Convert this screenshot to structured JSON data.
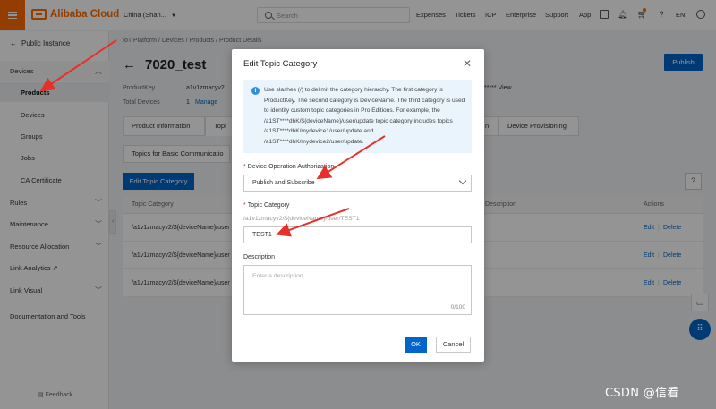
{
  "topbar": {
    "brand": "Alibaba Cloud",
    "region": "China (Shan...",
    "search_placeholder": "Search",
    "nav": [
      "Expenses",
      "Tickets",
      "ICP",
      "Enterprise",
      "Support",
      "App"
    ],
    "lang": "EN"
  },
  "sidebar": {
    "back": "Public Instance",
    "items": [
      {
        "label": "Devices"
      },
      {
        "label": "Products"
      },
      {
        "label": "Devices"
      },
      {
        "label": "Groups"
      },
      {
        "label": "Jobs"
      },
      {
        "label": "CA Certificate"
      },
      {
        "label": "Rules"
      },
      {
        "label": "Maintenance"
      },
      {
        "label": "Resource Allocation"
      },
      {
        "label": "Link Analytics"
      },
      {
        "label": "Link Visual"
      },
      {
        "label": "Documentation and Tools"
      }
    ],
    "feedback": "Feedback"
  },
  "main": {
    "breadcrumb": "IoT Platform  /  Devices  /  Products  /  Product Details",
    "title": "7020_test",
    "publish": "Publish",
    "product_key_label": "ProductKey",
    "product_key_value": "a1v1zmacyv2",
    "product_key_value_tail": "***** View",
    "total_devices_label": "Total Devices",
    "total_devices_value": "1",
    "manage": "Manage",
    "tabs": [
      "Product Information",
      "Topi",
      "n",
      "Device Provisioning"
    ],
    "subtab": "Topics for Basic Communicatio",
    "edit_topic_category": "Edit Topic Category",
    "help": "?",
    "table": {
      "headers": [
        "Topic Category",
        "Description",
        "Actions"
      ],
      "rows": [
        {
          "topic": "/a1v1zmacyv2/${deviceName}/user",
          "edit": "Edit",
          "delete": "Delete"
        },
        {
          "topic": "/a1v1zmacyv2/${deviceName}/user",
          "edit": "Edit",
          "delete": "Delete"
        },
        {
          "topic": "/a1v1zmacyv2/${deviceName}/user",
          "edit": "Edit",
          "delete": "Delete"
        }
      ]
    }
  },
  "dialog": {
    "title": "Edit Topic Category",
    "info": "Use slashes (/) to delimit the category hierarchy. The first category is ProductKey. The second category is DeviceName. The third category is used to identify custom topic categories in Pro Editions. For example, the /a1ST****dhK/${deviceName}/user/update topic category includes topics /a1ST****dhK/mydevice1/user/update and /a1ST****dhK/mydevice2/user/update.",
    "auth_label": "Device Operation Authorization",
    "auth_value": "Publish and Subscribe",
    "topic_label": "Topic Category",
    "topic_prefix": "/a1v1zmacyv2/${deviceName}/user/TEST1",
    "topic_value": "TEST1",
    "desc_label": "Description",
    "desc_placeholder": "Enter a description",
    "desc_count": "0/100",
    "ok": "OK",
    "cancel": "Cancel"
  },
  "watermark": "CSDN @信看",
  "colors": {
    "brand": "#ff6a00",
    "primary": "#0064c8",
    "annotation_arrow": "#e8302a"
  }
}
